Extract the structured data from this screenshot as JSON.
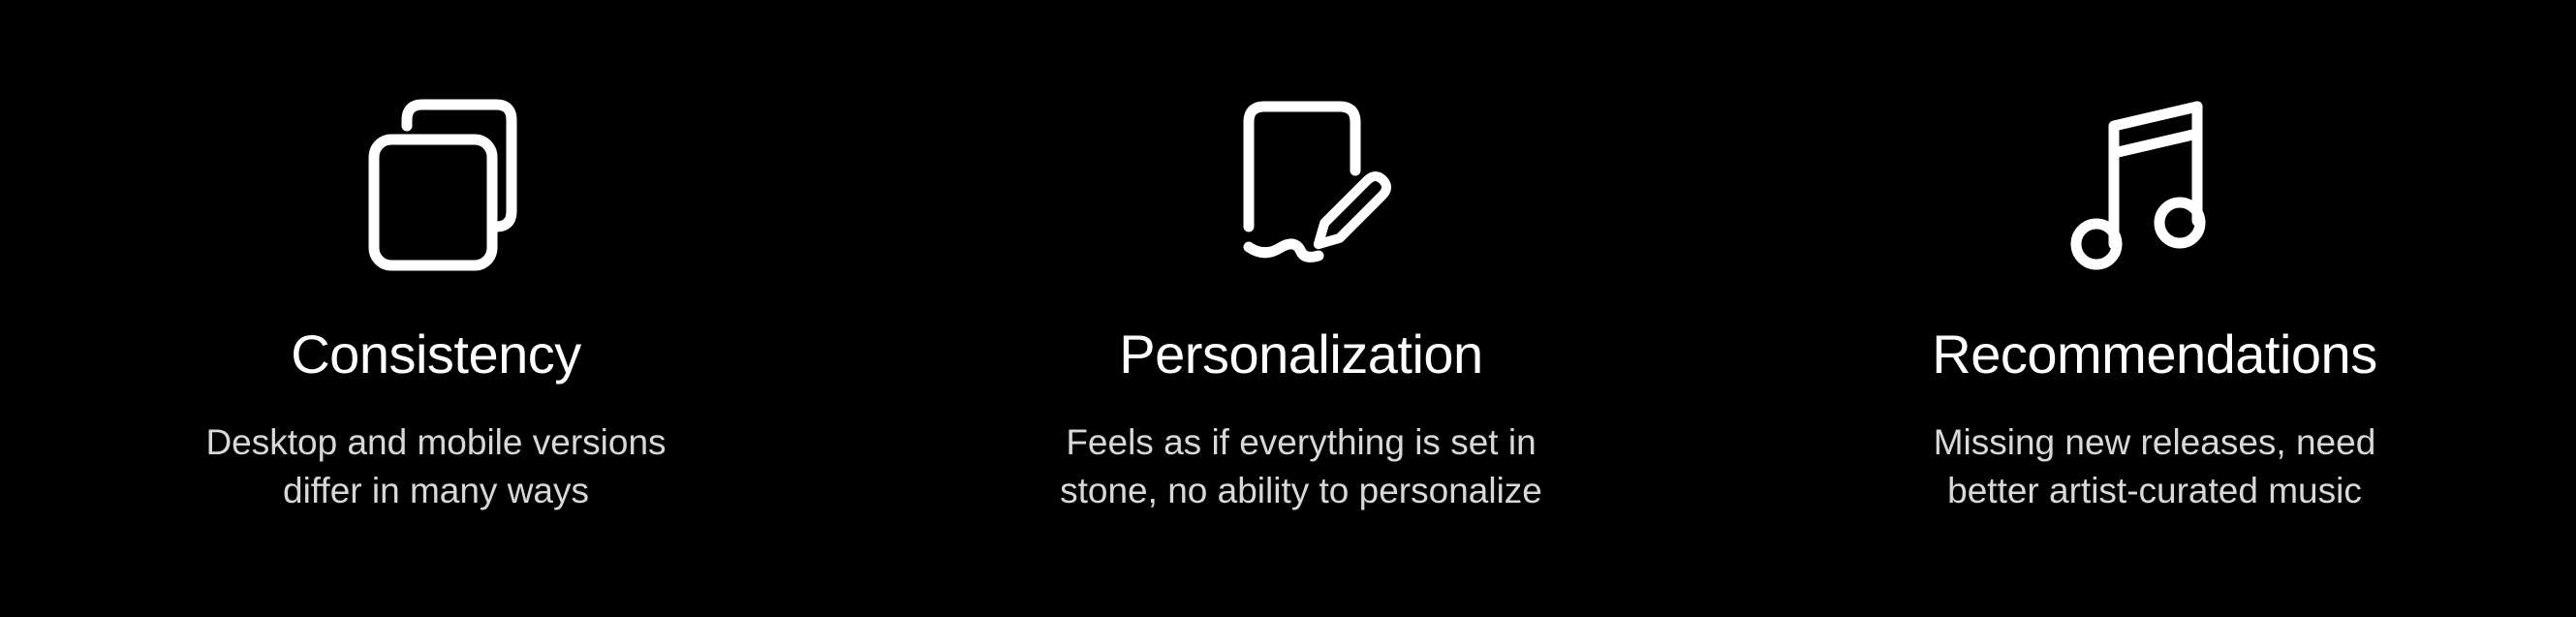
{
  "colors": {
    "background": "#000000",
    "title": "#ffffff",
    "description": "#d8d8d8",
    "icon": "#ffffff"
  },
  "features": [
    {
      "icon": "stacked-squares-icon",
      "title": "Consistency",
      "description_lines": [
        "Desktop and mobile versions",
        "differ in many ways"
      ]
    },
    {
      "icon": "square-pencil-icon",
      "title": "Personalization",
      "description_lines": [
        "Feels as if everything is set in",
        "stone, no ability to personalize"
      ]
    },
    {
      "icon": "music-note-icon",
      "title": "Recommendations",
      "description_lines": [
        "Missing new releases, need",
        "better artist-curated music"
      ]
    }
  ]
}
